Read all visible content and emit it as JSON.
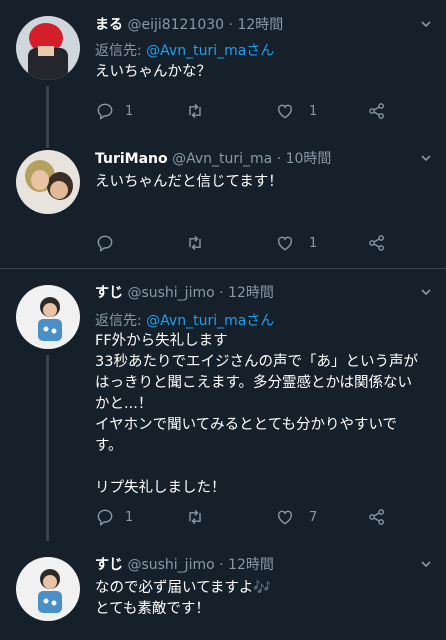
{
  "tweets": [
    {
      "name": "まる",
      "handle": "@eiji8121030",
      "dot": "·",
      "time": "12時間",
      "reply_prefix": "返信先: ",
      "reply_handle": "@Avn_turi_maさん",
      "lines": [
        "えいちゃんかな？"
      ],
      "reply_count": "1",
      "retweet_count": "",
      "like_count": "1"
    },
    {
      "name": "TuriMano",
      "handle": "@Avn_turi_ma",
      "dot": "·",
      "time": "10時間",
      "lines": [
        "えいちゃんだと信じてます！"
      ],
      "reply_count": "",
      "retweet_count": "",
      "like_count": "1"
    },
    {
      "name": "すじ",
      "handle": "@sushi_jimo",
      "dot": "·",
      "time": "12時間",
      "reply_prefix": "返信先: ",
      "reply_handle": "@Avn_turi_maさん",
      "lines": [
        "FF外から失礼します",
        "33秒あたりでエイジさんの声で「あ」という声が",
        "はっきりと聞こえます。多分霊感とかは関係ない",
        "かと...！",
        "イヤホンで聞いてみるととても分かりやすいで",
        "す。",
        "",
        "リプ失礼しました！"
      ],
      "reply_count": "1",
      "retweet_count": "",
      "like_count": "7"
    },
    {
      "name": "すじ",
      "handle": "@sushi_jimo",
      "dot": "·",
      "time": "12時間",
      "lines": [
        "なので必ず届いてますよ🎶",
        "とても素敵です！"
      ]
    }
  ],
  "colors": {
    "background": "#15202b",
    "text": "#ffffff",
    "muted": "#8899a6",
    "link": "#1da1f2",
    "divider": "#38444d"
  },
  "icons": {
    "reply": "reply-icon",
    "retweet": "retweet-icon",
    "like": "heart-icon",
    "share": "share-icon",
    "more": "chevron-down-icon"
  }
}
